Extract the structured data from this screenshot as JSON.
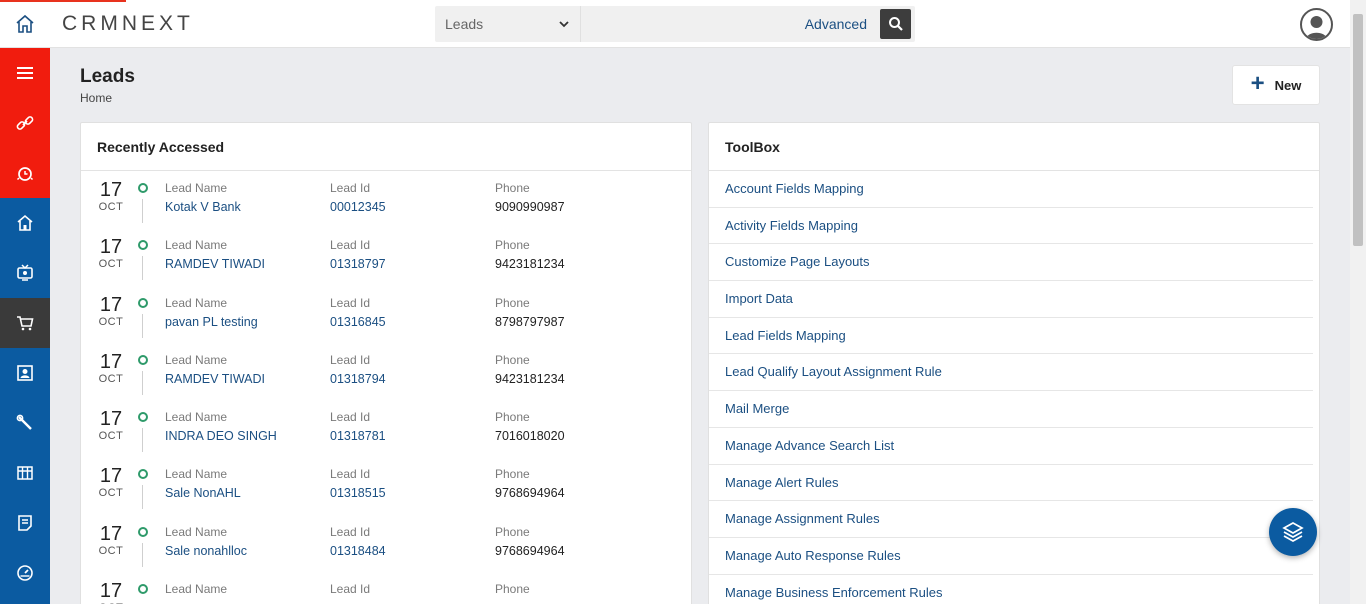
{
  "app": {
    "logo_text": "CRMNEXT"
  },
  "search": {
    "module": "Leads",
    "advanced_label": "Advanced"
  },
  "header": {
    "title": "Leads",
    "breadcrumb": "Home",
    "new_label": "New"
  },
  "recent": {
    "title": "Recently Accessed",
    "col_labels": {
      "name": "Lead Name",
      "id": "Lead Id",
      "phone": "Phone"
    },
    "rows": [
      {
        "day": "17",
        "month": "OCT",
        "name": "Kotak V Bank",
        "id": "00012345",
        "phone": "9090990987"
      },
      {
        "day": "17",
        "month": "OCT",
        "name": "RAMDEV TIWADI",
        "id": "01318797",
        "phone": "9423181234"
      },
      {
        "day": "17",
        "month": "OCT",
        "name": "pavan PL testing",
        "id": "01316845",
        "phone": "8798797987"
      },
      {
        "day": "17",
        "month": "OCT",
        "name": "RAMDEV TIWADI",
        "id": "01318794",
        "phone": "9423181234"
      },
      {
        "day": "17",
        "month": "OCT",
        "name": "INDRA DEO SINGH",
        "id": "01318781",
        "phone": "7016018020"
      },
      {
        "day": "17",
        "month": "OCT",
        "name": "Sale NonAHL",
        "id": "01318515",
        "phone": "9768694964"
      },
      {
        "day": "17",
        "month": "OCT",
        "name": "Sale nonahlloc",
        "id": "01318484",
        "phone": "9768694964"
      },
      {
        "day": "17",
        "month": "OCT",
        "name": "",
        "id": "",
        "phone": ""
      }
    ]
  },
  "toolbox": {
    "title": "ToolBox",
    "items": [
      "Account Fields Mapping",
      "Activity Fields Mapping",
      "Customize Page Layouts",
      "Import Data",
      "Lead Fields Mapping",
      "Lead Qualify Layout Assignment Rule",
      "Mail Merge",
      "Manage Advance Search List",
      "Manage Alert Rules",
      "Manage Assignment Rules",
      "Manage Auto Response Rules",
      "Manage Business Enforcement Rules"
    ]
  },
  "colors": {
    "sidebar": "#0b5ba1",
    "sidebar_red": "#f11c0e",
    "link": "#1b4f82",
    "timeline_dot": "#2e9a6a"
  },
  "icons": {
    "sidebar": [
      "menu-icon",
      "link-icon",
      "alarm-icon",
      "home-icon",
      "tv-icon",
      "cart-icon",
      "contact-icon",
      "wrench-icon",
      "grid-icon",
      "notes-icon",
      "dashboard-icon"
    ]
  }
}
